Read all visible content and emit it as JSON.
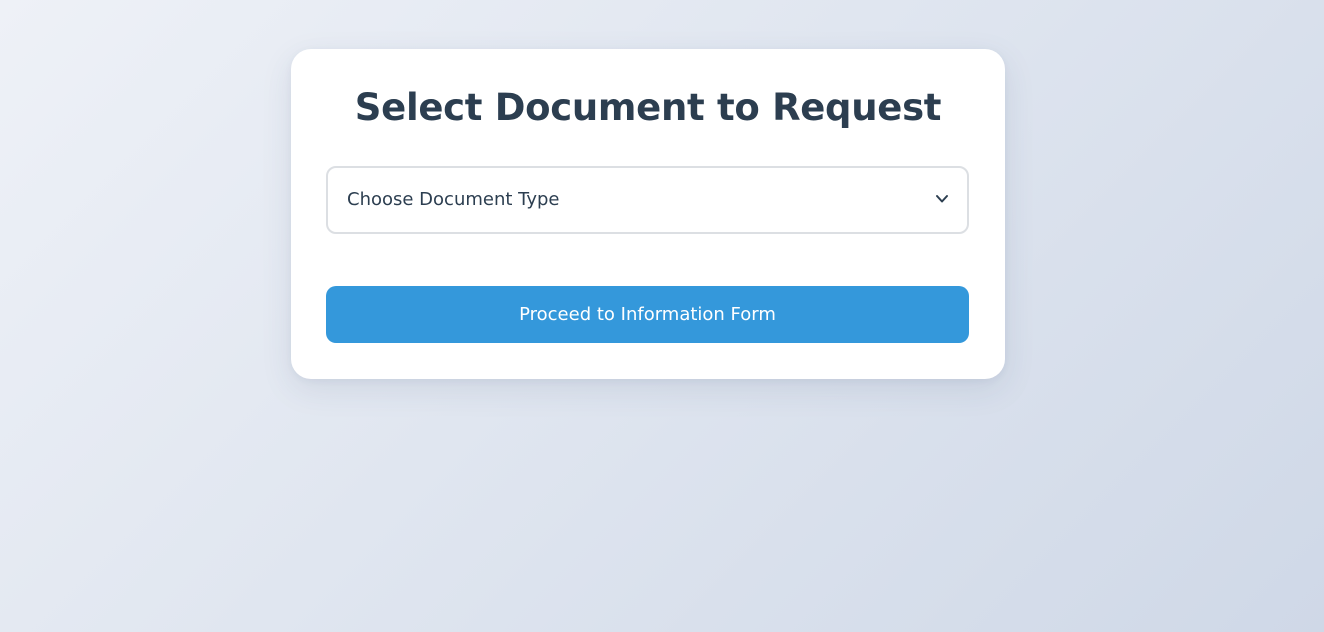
{
  "card": {
    "title": "Select Document to Request"
  },
  "document_select": {
    "selected": "Choose Document Type",
    "icon": "chevron-down-icon"
  },
  "proceed_button": {
    "label": "Proceed to Information Form"
  },
  "colors": {
    "title": "#2c3e50",
    "button_bg": "#3498db",
    "button_text": "#ffffff",
    "select_border": "#dcdfe3"
  }
}
